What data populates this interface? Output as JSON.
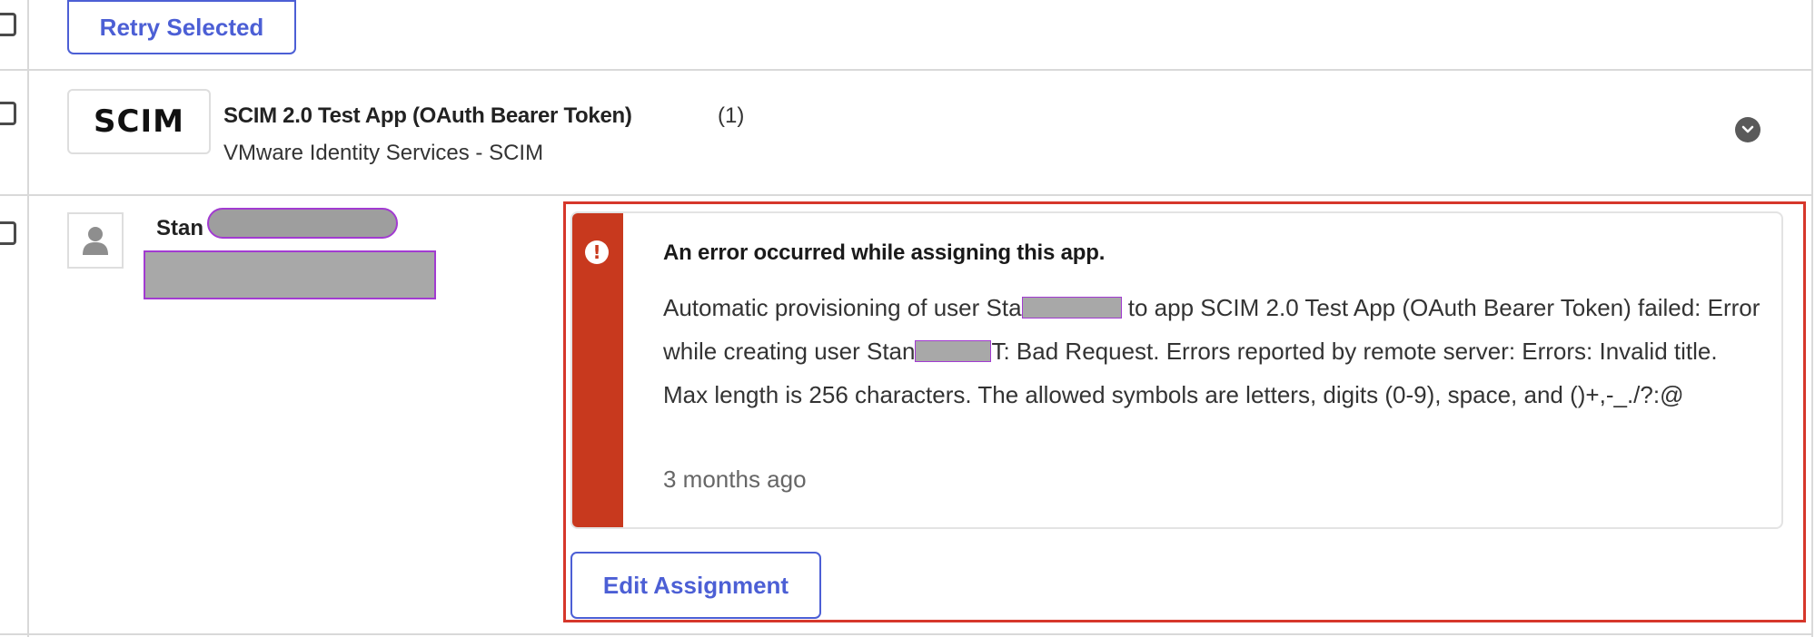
{
  "toolbar": {
    "retry_label": "Retry Selected"
  },
  "app": {
    "logo_text": "SCIM",
    "name": "SCIM 2.0 Test App (OAuth Bearer Token)",
    "count": "(1)",
    "subtitle": "VMware Identity Services - SCIM",
    "expand_icon": "chevron-down-icon"
  },
  "assignment": {
    "user_name_visible": "Stan",
    "avatar_icon": "user-icon",
    "alert": {
      "icon": "exclamation-circle-icon",
      "title": "An error occurred while assigning this app.",
      "msg_part1": "Automatic provisioning of user Sta",
      "msg_part2": " to app SCIM 2.0 Test App (OAuth Bearer Token) failed: Error while creating user Stan",
      "msg_part3": "T: Bad Request. Errors reported by remote server: Errors: Invalid title. Max length is 256 characters. The allowed symbols are letters, digits (0-9), space, and ()+,-_./?:@",
      "timestamp": "3 months ago",
      "accent_color": "#c8391e"
    },
    "edit_label": "Edit Assignment"
  },
  "colors": {
    "primary": "#4c5fd5",
    "highlight_frame": "#d6372b",
    "redaction": "#a8a8a8"
  }
}
